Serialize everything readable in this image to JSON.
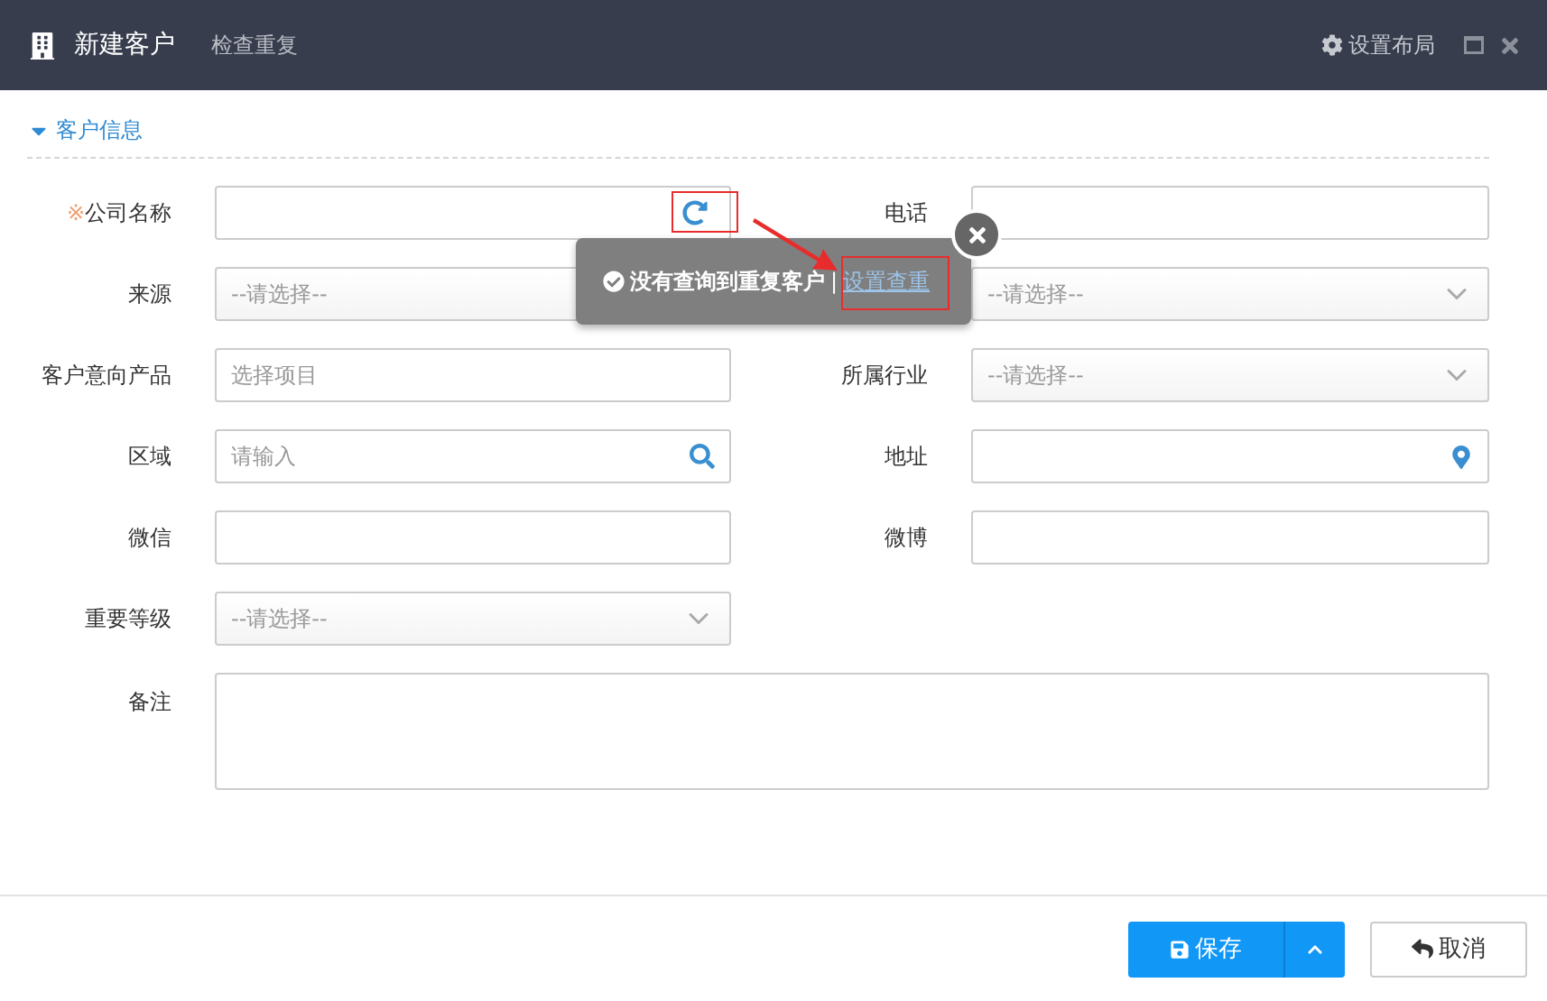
{
  "header": {
    "title": "新建客户",
    "check_link": "检查重复",
    "layout_button": "设置布局"
  },
  "section": {
    "title": "客户信息",
    "expanded": true
  },
  "fields": [
    {
      "label": "公司名称",
      "required_mark": "※",
      "kind": "refresh"
    },
    {
      "label": "电话",
      "kind": "text"
    },
    {
      "label": "来源",
      "kind": "select",
      "placeholder": "--请选择--"
    },
    {
      "kind": "select",
      "placeholder": "--请选择--"
    },
    {
      "label": "客户意向产品",
      "kind": "text",
      "placeholder": "选择项目"
    },
    {
      "label": "所属行业",
      "kind": "select",
      "placeholder": "--请选择--"
    },
    {
      "label": "区域",
      "kind": "search",
      "placeholder": "请输入"
    },
    {
      "label": "地址",
      "kind": "location"
    },
    {
      "label": "微信",
      "kind": "text"
    },
    {
      "label": "微博",
      "kind": "text"
    },
    {
      "label": "重要等级",
      "kind": "select",
      "placeholder": "--请选择--"
    },
    {
      "label": "备注",
      "kind": "textarea"
    }
  ],
  "popover": {
    "message": "没有查询到重复客户",
    "separator": "|",
    "link": "设置查重"
  },
  "footer": {
    "save": "保存",
    "cancel": "取消"
  }
}
